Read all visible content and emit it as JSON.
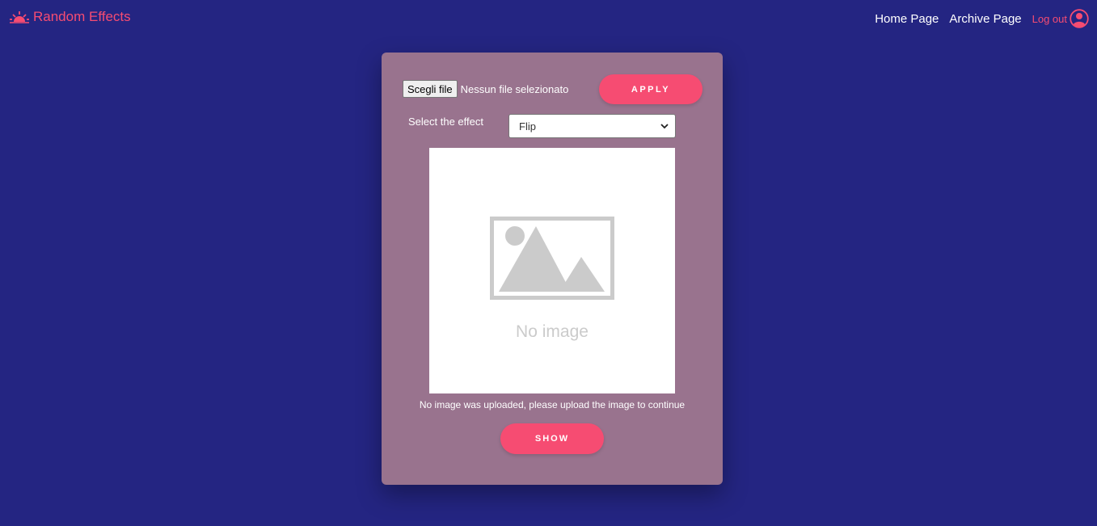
{
  "navbar": {
    "brand": "Random Effects",
    "links": {
      "home": "Home Page",
      "archive": "Archive Page"
    },
    "logout": "Log out"
  },
  "form": {
    "file_button": "Scegli file",
    "file_status": "Nessun file selezionato",
    "apply_label": "APPLY",
    "effect_label": "Select the effect",
    "effect_selected": "Flip",
    "preview_placeholder": "No image",
    "upload_message": "No image was uploaded, please upload the image to continue",
    "show_label": "SHOW"
  },
  "colors": {
    "background": "#242582",
    "card": "#99738e",
    "accent": "#f64c72"
  },
  "icons": {
    "brand": "sunrise-icon",
    "user": "user-circle-icon",
    "select": "chevron-down-icon",
    "placeholder": "image-placeholder-icon"
  }
}
